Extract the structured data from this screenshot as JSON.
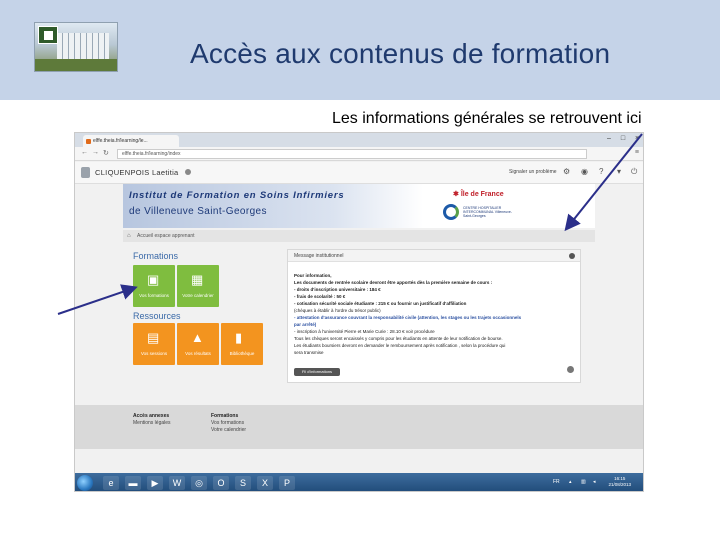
{
  "slide": {
    "title": "Accès aux contenus de formation",
    "subtitle": "Les informations générales se retrouvent ici"
  },
  "browser": {
    "tab_title": "elffe.theia.fr/learning/le...",
    "url": "elffe.theia.fr/learning/index",
    "back_icon": "back-icon",
    "forward_icon": "forward-icon",
    "reload_icon": "reload-icon"
  },
  "app": {
    "user_name": "CLIQUENPOIS Laetitia",
    "report_label": "Signaler un problème",
    "banner_line1": "Institut de Formation en Soins Infirmiers",
    "banner_line2": "de Villeneuve Saint-Georges",
    "idf_label": "Île de France",
    "chic_text": "CENTRE HOSPITALIER INTERCOMMUNAL Villeneuve-Saint-Georges",
    "breadcrumb": "Accueil espace apprenant"
  },
  "formations": {
    "title": "Formations",
    "tiles": [
      {
        "label": "Vos formations",
        "icon": "presentation-icon"
      },
      {
        "label": "Votre calendrier",
        "icon": "calendar-icon"
      }
    ]
  },
  "ressources": {
    "title": "Ressources",
    "tiles": [
      {
        "label": "Vos sessions",
        "icon": "briefcase-icon"
      },
      {
        "label": "Vos résultats",
        "icon": "graduation-cap-icon"
      },
      {
        "label": "Bibliothèque",
        "icon": "book-icon"
      }
    ]
  },
  "message_panel": {
    "title": "Message institutionnel",
    "lines": [
      "Pour information,",
      "Les documents de rentrée scolaire devront être apportés dès la première semaine de cours :",
      "- droits d'inscription universitaire : 184 €",
      "- frais de scolarité : 50 €",
      "- cotisation sécurité sociale étudiante : 215 € ou fournir un justificatif d'affiliation",
      "(chèques à établir à l'ordre du trésor public)",
      "- attestation d'assurance couvrant la responsabilité civile (attention, les stages ou les trajets occasionnels",
      "par arrêté)",
      "- inscription à l'université Pierre et Marie Curie : 28.10 € voir procédure",
      "Tous les chèques seront encaissés y compris pour les étudiants en attente de leur notification de bourse.",
      "Les étudiants boursiers devront en demander le remboursement après notification , selon la procédure qui",
      "sera transmise"
    ],
    "button": "Fil d'informations"
  },
  "footer": {
    "col1_title": "Accès annexes",
    "col1_item": "Mentions légales",
    "col2_title": "Formations",
    "col2_items": [
      "Vos formations",
      "Votre calendrier"
    ]
  },
  "taskbar": {
    "lang": "FR",
    "time": "16:15",
    "date": "21/08/2013"
  }
}
